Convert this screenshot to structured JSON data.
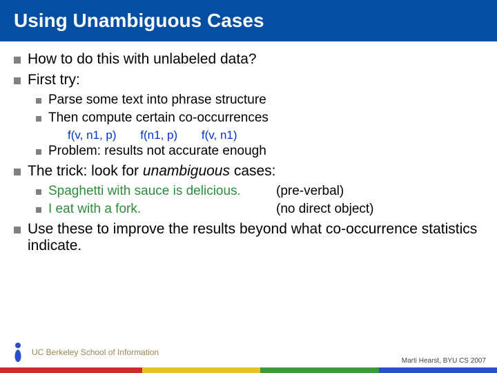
{
  "title": "Using Unambiguous Cases",
  "bullets": {
    "b1": "How to do this with unlabeled data?",
    "b2": "First try:",
    "b2a": "Parse some text into phrase structure",
    "b2b": "Then compute certain co-occurrences",
    "b2c": "Problem: results not accurate enough",
    "b3_pre": "The trick: look for ",
    "b3_em": "unambiguous",
    "b3_post": " cases:",
    "b3a_lhs": "Spaghetti with sauce is delicious.",
    "b3a_rhs": "(pre-verbal)",
    "b3b_lhs": "I eat with a fork.",
    "b3b_rhs": "(no direct object)",
    "b4": "Use these to improve the results beyond what co-occurrence statistics indicate."
  },
  "formulas": {
    "f1": "f(v, n1, p)",
    "f2": "f(n1, p)",
    "f3": "f(v, n1)"
  },
  "footer": {
    "school": "UC Berkeley School of Information",
    "credit": "Marti Hearst, BYU CS 2007"
  }
}
